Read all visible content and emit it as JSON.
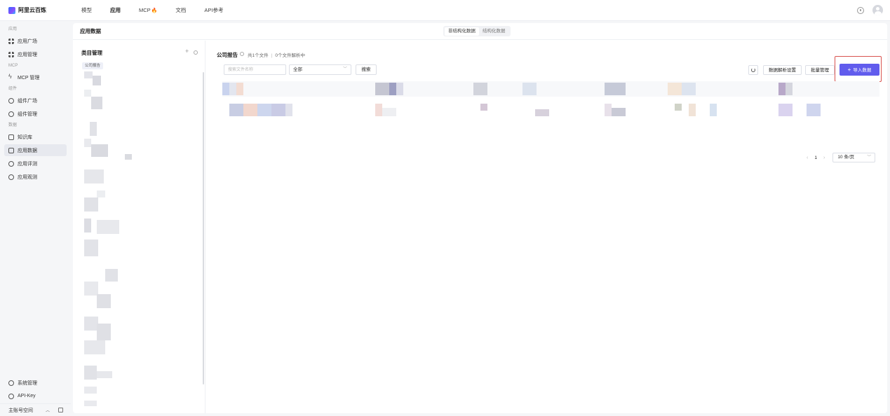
{
  "brand": {
    "name": "阿里云百炼"
  },
  "topnav": {
    "items": [
      {
        "label": "模型"
      },
      {
        "label": "应用"
      },
      {
        "label": "MCP"
      },
      {
        "label": "文档"
      },
      {
        "label": "API参考"
      }
    ]
  },
  "sidebar": {
    "sections": {
      "apps": "应用",
      "mcp": "MCP",
      "components": "组件",
      "data": "数据"
    },
    "items": {
      "app_square": "应用广场",
      "app_manage": "应用管理",
      "mcp_manage": "MCP 管理",
      "comp_square": "组件广场",
      "comp_manage": "组件管理",
      "knowledge": "知识库",
      "app_data": "应用数据",
      "app_eval": "应用评测",
      "app_observe": "应用观测"
    },
    "bottom": {
      "system": "系统管理",
      "apikey": "API-Key",
      "workspace": "主账号空间"
    }
  },
  "main": {
    "title": "应用数据",
    "tabs": {
      "unstructured": "非结构化数据",
      "structured": "结构化数据"
    },
    "category": {
      "title": "类目管理",
      "active_tag": "公司报告"
    },
    "content": {
      "title": "公司报告",
      "file_count": "共1个文件",
      "parsing": "0个文件解析中",
      "search_placeholder": "搜索文件名称",
      "filter_value": "全部",
      "search_btn": "搜索",
      "parse_settings_btn": "数据解析设置",
      "batch_btn": "批量管理",
      "import_btn": "导入数据"
    },
    "pagination": {
      "page": "1",
      "page_size": "10 条/页"
    }
  },
  "colors": {
    "accent": "#615ced",
    "highlight": "#d9534f"
  }
}
